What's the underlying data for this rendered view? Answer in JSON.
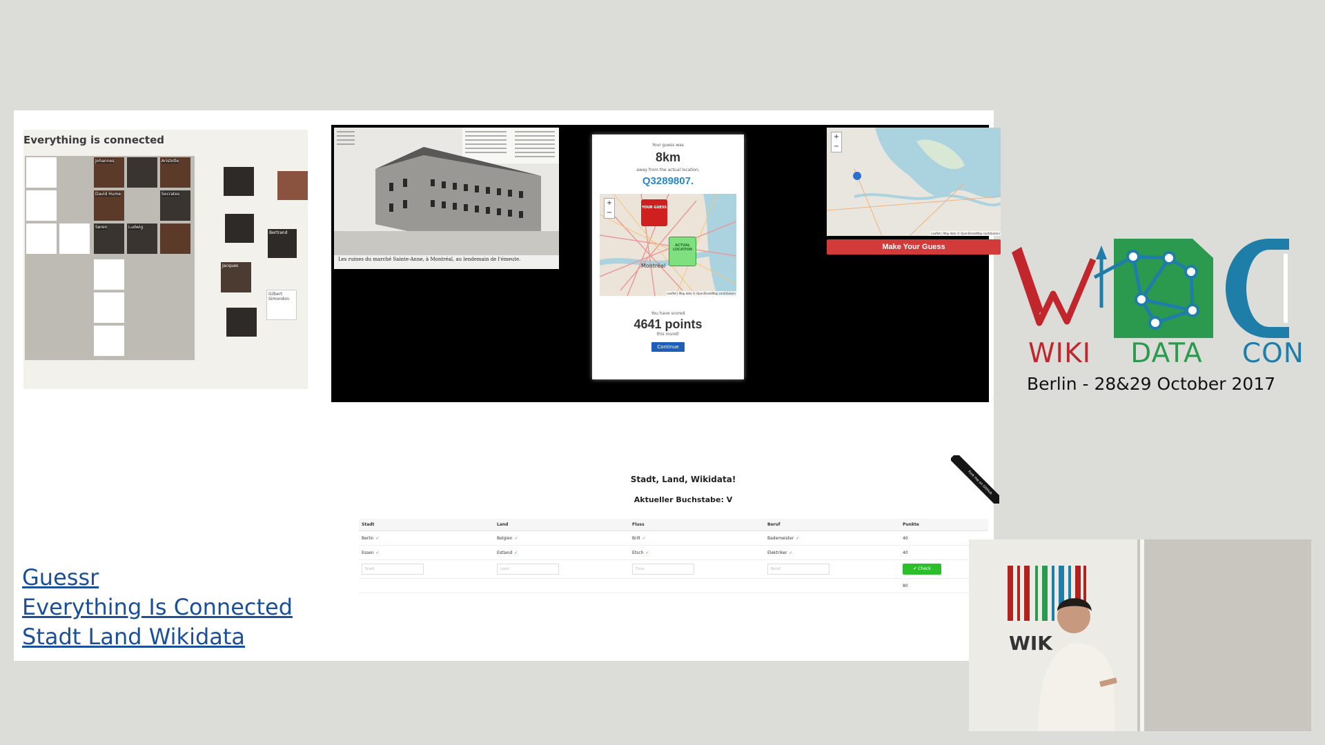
{
  "eic": {
    "title": "Everything is connected",
    "portrait_labels": [
      "Johannes",
      "",
      "Aristotle",
      "David Hume",
      "Socrates",
      "Søren",
      "Ludwig",
      "",
      "Bertrand",
      "Jacques",
      "Gilbert Simondon"
    ]
  },
  "guessr": {
    "caption": "Les ruines du marché Sainte-Anne, à Montréal, au lendemain de l'émeute.",
    "your_guess_was": "Your guess was",
    "distance": "8km",
    "away_text": "away from the actual location,",
    "qid": "Q3289807",
    "qid_suffix": ".",
    "pin_guess": "YOUR GUESS",
    "pin_actual": "ACTUAL LOCATION",
    "map_label": "Montréal",
    "attribution": "Leaflet | Map data © OpenStreetMap contributors",
    "scored": "You have scored",
    "points": "4641 points",
    "round": "this round!",
    "continue": "Continue",
    "zoom_in": "+",
    "zoom_out": "−",
    "make_guess": "Make Your Guess"
  },
  "slw": {
    "title": "Stadt, Land, Wikidata!",
    "letter": "Aktueller Buchstabe: V",
    "fork": "Fork me on GitHub",
    "columns": [
      "Stadt",
      "Land",
      "Fluss",
      "Beruf",
      "Punkte"
    ],
    "rows": [
      [
        "Berlin",
        "Belgien",
        "Brill",
        "Bademeister",
        "40"
      ],
      [
        "Essen",
        "Estland",
        "Etsch",
        "Elektriker",
        "40"
      ]
    ],
    "placeholders": [
      "Stadt",
      "Land",
      "Fluss",
      "Beruf"
    ],
    "check": "✔ Check",
    "total": "80"
  },
  "links": [
    "Guessr",
    "Everything Is Connected",
    "Stadt Land Wikidata"
  ],
  "logo": {
    "wiki": "WIKI",
    "data": "DATA",
    "con": "CON",
    "subtitle": "Berlin - 28&29 October 2017"
  },
  "colors": {
    "slide_bg": "#ffffff",
    "page_bg": "#dcdcd8",
    "link": "#1a4f9a",
    "wiki_red": "#c0262c",
    "data_green": "#2b9a4e",
    "con_blue": "#1e7ea8",
    "qid_blue": "#2b87c8",
    "make_guess_red": "#d33a3a"
  }
}
